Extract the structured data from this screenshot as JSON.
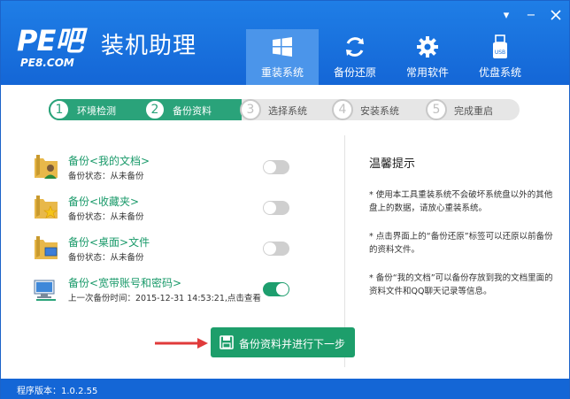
{
  "header": {
    "logo_main": "PE吧",
    "logo_sub": "PE8.COM",
    "app_title": "装机助理",
    "minimize": "▾",
    "close": "−"
  },
  "nav": [
    {
      "label": "重装系统",
      "icon": "windows-icon",
      "active": true
    },
    {
      "label": "备份还原",
      "icon": "refresh-icon",
      "active": false
    },
    {
      "label": "常用软件",
      "icon": "gear-icon",
      "active": false
    },
    {
      "label": "优盘系统",
      "icon": "usb-icon",
      "active": false
    }
  ],
  "steps": [
    {
      "num": "1",
      "label": "环境检测",
      "done": true
    },
    {
      "num": "2",
      "label": "备份资料",
      "done": true
    },
    {
      "num": "3",
      "label": "选择系统",
      "done": false
    },
    {
      "num": "4",
      "label": "安装系统",
      "done": false
    },
    {
      "num": "5",
      "label": "完成重启",
      "done": false
    }
  ],
  "backup_items": [
    {
      "title": "备份<我的文档>",
      "status": "备份状态：从未备份",
      "on": false,
      "icon": "user-folder-icon"
    },
    {
      "title": "备份<收藏夹>",
      "status": "备份状态：从未备份",
      "on": false,
      "icon": "star-folder-icon"
    },
    {
      "title": "备份<桌面>文件",
      "status": "备份状态：从未备份",
      "on": false,
      "icon": "desktop-folder-icon"
    },
    {
      "title": "备份<宽带账号和密码>",
      "status": "上一次备份时间：2015-12-31 14:53:21,点击查看",
      "on": true,
      "icon": "network-icon"
    }
  ],
  "tips": {
    "title": "温馨提示",
    "items": [
      "* 使用本工具重装系统不会破坏系统盘以外的其他盘上的数据，请放心重装系统。",
      "* 点击界面上的“备份还原”标签可以还原以前备份的资料文件。",
      "* 备份“我的文档”可以备份存放到我的文档里面的资料文件和QQ聊天记录等信息。"
    ]
  },
  "action_button": "备份资料并进行下一步",
  "footer": {
    "version": "程序版本：1.0.2.55"
  },
  "colors": {
    "primary": "#1466d6",
    "accent": "#1d9e6b",
    "arrow": "#e03b3b"
  }
}
